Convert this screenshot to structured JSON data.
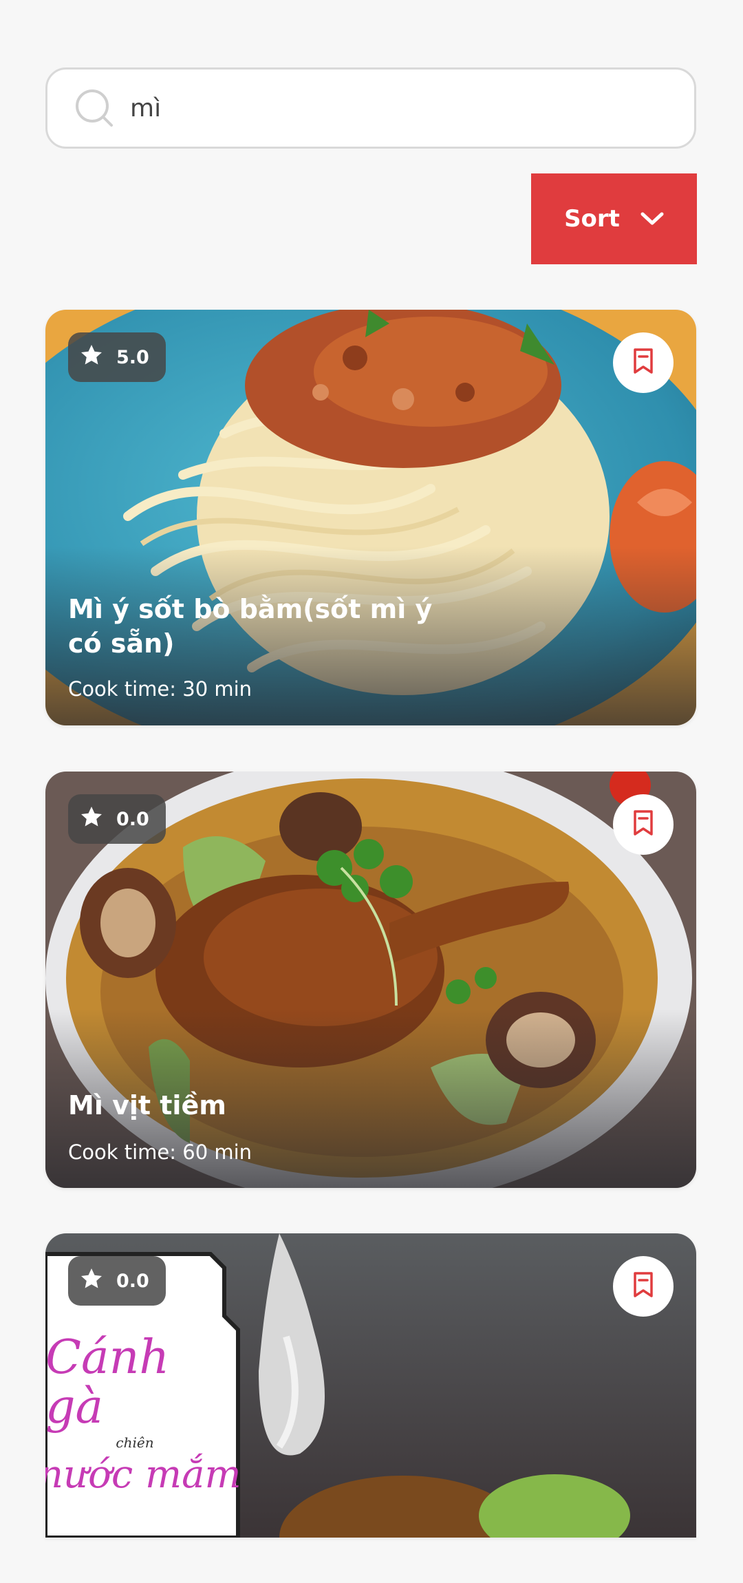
{
  "search": {
    "value": "mì",
    "icon": "search-icon"
  },
  "sort": {
    "label": "Sort",
    "icon": "chevron-down-icon"
  },
  "colors": {
    "accent": "#e03c3e",
    "bookmark": "#e03c3e"
  },
  "recipes": [
    {
      "rating": "5.0",
      "title": "Mì ý sốt bò bằm(sốt mì ý có sẵn)",
      "cook_time": "Cook time: 30 min",
      "image": "spaghetti-bolognese-photo"
    },
    {
      "rating": "0.0",
      "title": "Mì vịt tiềm",
      "cook_time": "Cook time: 60 min",
      "image": "duck-noodle-soup-photo"
    },
    {
      "rating": "0.0",
      "image": "fried-chicken-wings-fish-sauce-photo",
      "image_text": {
        "line1": "Cánh gà",
        "line2": "chiên",
        "line3": "nước mắm"
      }
    }
  ]
}
